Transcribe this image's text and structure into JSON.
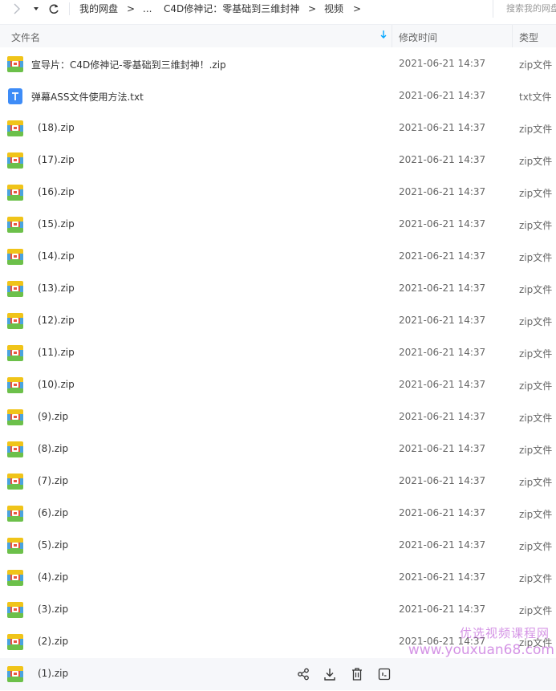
{
  "nav": {
    "breadcrumbs": [
      "我的网盘",
      "...",
      "C4D修神记：零基础到三维封神",
      "视频"
    ],
    "separator": ">",
    "search_placeholder": "搜索我的网盘文件"
  },
  "header": {
    "col_name": "文件名",
    "col_modified": "修改时间",
    "col_type": "类型",
    "sort_icon": "sort-down-arrow-icon"
  },
  "files": [
    {
      "name": "宣导片：C4D修神记-零基础到三维封神！.zip",
      "time": "2021-06-21 14:37",
      "type": "zip文件",
      "icon": "zip-file-icon"
    },
    {
      "name": "弹幕ASS文件使用方法.txt",
      "time": "2021-06-21 14:37",
      "type": "txt文件",
      "icon": "txt-file-icon"
    },
    {
      "name": " (18).zip",
      "time": "2021-06-21 14:37",
      "type": "zip文件",
      "icon": "zip-file-icon"
    },
    {
      "name": " (17).zip",
      "time": "2021-06-21 14:37",
      "type": "zip文件",
      "icon": "zip-file-icon"
    },
    {
      "name": " (16).zip",
      "time": "2021-06-21 14:37",
      "type": "zip文件",
      "icon": "zip-file-icon"
    },
    {
      "name": " (15).zip",
      "time": "2021-06-21 14:37",
      "type": "zip文件",
      "icon": "zip-file-icon"
    },
    {
      "name": " (14).zip",
      "time": "2021-06-21 14:37",
      "type": "zip文件",
      "icon": "zip-file-icon"
    },
    {
      "name": " (13).zip",
      "time": "2021-06-21 14:37",
      "type": "zip文件",
      "icon": "zip-file-icon"
    },
    {
      "name": " (12).zip",
      "time": "2021-06-21 14:37",
      "type": "zip文件",
      "icon": "zip-file-icon"
    },
    {
      "name": " (11).zip",
      "time": "2021-06-21 14:37",
      "type": "zip文件",
      "icon": "zip-file-icon"
    },
    {
      "name": " (10).zip",
      "time": "2021-06-21 14:37",
      "type": "zip文件",
      "icon": "zip-file-icon"
    },
    {
      "name": " (9).zip",
      "time": "2021-06-21 14:37",
      "type": "zip文件",
      "icon": "zip-file-icon"
    },
    {
      "name": " (8).zip",
      "time": "2021-06-21 14:37",
      "type": "zip文件",
      "icon": "zip-file-icon"
    },
    {
      "name": " (7).zip",
      "time": "2021-06-21 14:37",
      "type": "zip文件",
      "icon": "zip-file-icon"
    },
    {
      "name": " (6).zip",
      "time": "2021-06-21 14:37",
      "type": "zip文件",
      "icon": "zip-file-icon"
    },
    {
      "name": " (5).zip",
      "time": "2021-06-21 14:37",
      "type": "zip文件",
      "icon": "zip-file-icon"
    },
    {
      "name": " (4).zip",
      "time": "2021-06-21 14:37",
      "type": "zip文件",
      "icon": "zip-file-icon"
    },
    {
      "name": " (3).zip",
      "time": "2021-06-21 14:37",
      "type": "zip文件",
      "icon": "zip-file-icon"
    },
    {
      "name": " (2).zip",
      "time": "2021-06-21 14:37",
      "type": "zip文件",
      "icon": "zip-file-icon"
    },
    {
      "name": " (1).zip",
      "time": "",
      "type": "",
      "icon": "zip-file-icon"
    }
  ],
  "hover_actions": [
    "share-icon",
    "download-icon",
    "delete-icon",
    "more-icon"
  ],
  "watermark": {
    "line1": "优选视频课程网",
    "line2": "www.youxuan68.com"
  },
  "colors": {
    "accent": "#06a7ff",
    "hover_row": "#f6f7fa",
    "header_bg": "#f7f8fa"
  }
}
